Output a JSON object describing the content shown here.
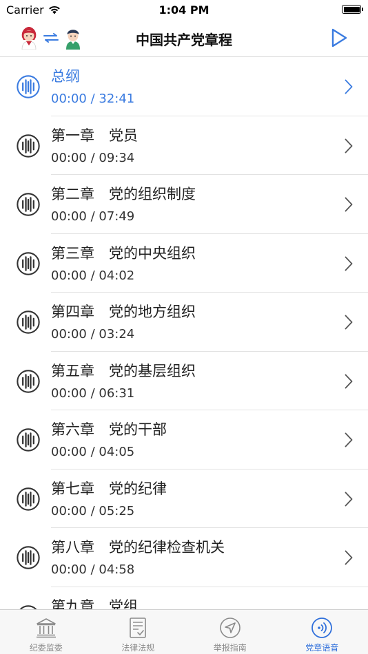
{
  "status_bar": {
    "carrier": "Carrier",
    "time": "1:04 PM"
  },
  "nav": {
    "title": "中国共产党章程"
  },
  "colors": {
    "accent": "#3a7be0",
    "icon_dark": "#333333",
    "chevron": "#555555",
    "tab_inactive": "#8a8a8a"
  },
  "chapters": [
    {
      "title": "总纲",
      "time": "00:00 / 32:41",
      "active": true
    },
    {
      "title": "第一章　党员",
      "time": "00:00 / 09:34"
    },
    {
      "title": "第二章　党的组织制度",
      "time": "00:00 / 07:49"
    },
    {
      "title": "第三章　党的中央组织",
      "time": "00:00 / 04:02"
    },
    {
      "title": "第四章　党的地方组织",
      "time": "00:00 / 03:24"
    },
    {
      "title": "第五章　党的基层组织",
      "time": "00:00 / 06:31"
    },
    {
      "title": "第六章　党的干部",
      "time": "00:00 / 04:05"
    },
    {
      "title": "第七章　党的纪律",
      "time": "00:00 / 05:25"
    },
    {
      "title": "第八章　党的纪律检查机关",
      "time": "00:00 / 04:58"
    },
    {
      "title": "第九章　党组",
      "time": ""
    }
  ],
  "tabs": [
    {
      "label": "纪委监委",
      "icon": "building-icon"
    },
    {
      "label": "法律法规",
      "icon": "document-icon"
    },
    {
      "label": "举报指南",
      "icon": "navigation-icon"
    },
    {
      "label": "党章语音",
      "icon": "audio-icon",
      "active": true
    }
  ]
}
